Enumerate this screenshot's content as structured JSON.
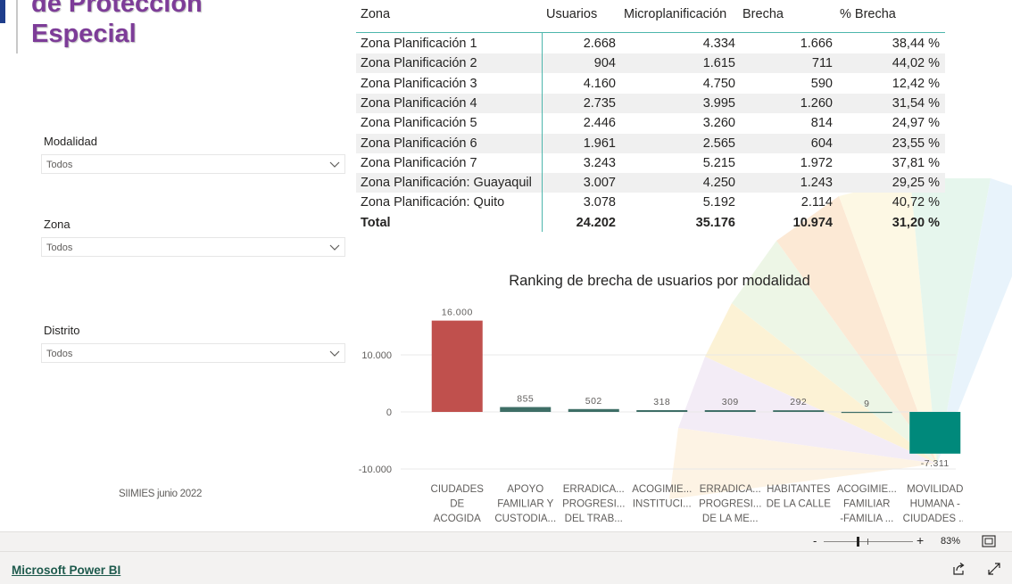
{
  "title": {
    "line1": "de Protección",
    "line2": "Especial"
  },
  "slicers": [
    {
      "label": "Modalidad",
      "value": "Todos"
    },
    {
      "label": "Zona",
      "value": "Todos"
    },
    {
      "label": "Distrito",
      "value": "Todos"
    }
  ],
  "footer_note": "SIIMIES junio 2022",
  "table": {
    "headers": [
      "Zona",
      "Usuarios",
      "Microplanificación",
      "Brecha",
      "% Brecha"
    ],
    "rows": [
      [
        "Zona Planificación 1",
        "2.668",
        "4.334",
        "1.666",
        "38,44 %"
      ],
      [
        "Zona Planificación 2",
        "904",
        "1.615",
        "711",
        "44,02 %"
      ],
      [
        "Zona Planificación 3",
        "4.160",
        "4.750",
        "590",
        "12,42 %"
      ],
      [
        "Zona Planificación 4",
        "2.735",
        "3.995",
        "1.260",
        "31,54 %"
      ],
      [
        "Zona Planificación 5",
        "2.446",
        "3.260",
        "814",
        "24,97 %"
      ],
      [
        "Zona Planificación 6",
        "1.961",
        "2.565",
        "604",
        "23,55 %"
      ],
      [
        "Zona Planificación 7",
        "3.243",
        "5.215",
        "1.972",
        "37,81 %"
      ],
      [
        "Zona Planificación: Guayaquil",
        "3.007",
        "4.250",
        "1.243",
        "29,25 %"
      ],
      [
        "Zona Planificación: Quito",
        "3.078",
        "5.192",
        "2.114",
        "40,72 %"
      ]
    ],
    "total": [
      "Total",
      "24.202",
      "35.176",
      "10.974",
      "31,20 %"
    ]
  },
  "chart_data": {
    "type": "bar",
    "title": "Ranking de brecha de usuarios por modalidad",
    "categories": [
      [
        "CIUDADES",
        "DE",
        "ACOGIDA"
      ],
      [
        "APOYO",
        "FAMILIAR Y",
        "CUSTODIA..."
      ],
      [
        "ERRADICA...",
        "PROGRESI...",
        "DEL TRAB..."
      ],
      [
        "ACOGIMIE...",
        "INSTITUCI..."
      ],
      [
        "ERRADICA...",
        "PROGRESI...",
        "DE LA ME..."
      ],
      [
        "HABITANTES",
        "DE LA CALLE"
      ],
      [
        "ACOGIMIE...",
        "FAMILIAR",
        "-FAMILIA ..."
      ],
      [
        "MOVILIDAD",
        "HUMANA -",
        "CIUDADES ..."
      ]
    ],
    "values": [
      16000,
      855,
      502,
      318,
      309,
      292,
      9,
      -7311
    ],
    "value_labels": [
      "16.000",
      "855",
      "502",
      "318",
      "309",
      "292",
      "9",
      "-7.311"
    ],
    "y_ticks": [
      10000,
      0,
      -10000
    ],
    "y_tick_labels": [
      "10.000",
      "0",
      "-10.000"
    ],
    "ylim": [
      -10000,
      16000
    ],
    "colors": {
      "top": "#c0504d",
      "positive": "#3e6e66",
      "negative": "#00897b"
    },
    "grid": true
  },
  "zoom": {
    "minus": "-",
    "plus": "+",
    "percent": "83%"
  },
  "powerbi_link": "Microsoft Power BI",
  "icons": {
    "share": "share-icon",
    "expand": "expand-icon",
    "fit": "fit-to-page-icon"
  }
}
